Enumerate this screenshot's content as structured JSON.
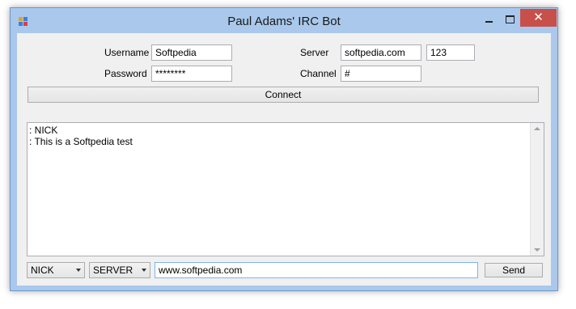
{
  "window": {
    "title": "Paul Adams' IRC Bot",
    "close_glyph": "✕"
  },
  "login": {
    "username_label": "Username",
    "username_value": "Softpedia",
    "password_label": "Password",
    "password_value": "********",
    "server_label": "Server",
    "server_value": "softpedia.com",
    "port_value": "123",
    "channel_label": "Channel",
    "channel_value": "#"
  },
  "connect_label": "Connect",
  "log": {
    "lines": [
      ": NICK",
      ": This is a Softpedia test"
    ]
  },
  "footer": {
    "target_select": "NICK",
    "type_select": "SERVER",
    "message_value": "www.softpedia.com",
    "send_label": "Send"
  },
  "colors": {
    "frame": "#a9c8ec",
    "close": "#c7504a"
  }
}
